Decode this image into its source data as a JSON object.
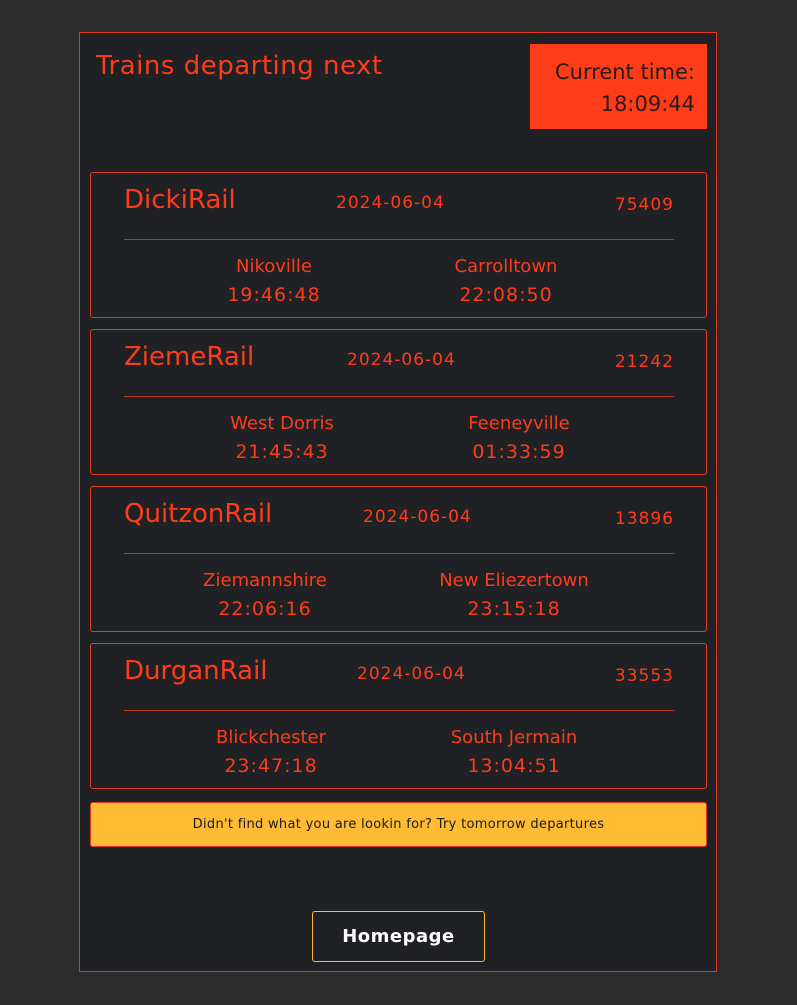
{
  "header": {
    "title": "Trains departing next",
    "current_time_label": "Current time:",
    "current_time_value": "18:09:44"
  },
  "departures": [
    {
      "operator": "DickiRail",
      "date": "2024-06-04",
      "number": "75409",
      "from_station": "Nikoville",
      "from_time": "19:46:48",
      "to_station": "Carrolltown",
      "to_time": "22:08:50"
    },
    {
      "operator": "ZiemeRail",
      "date": "2024-06-04",
      "number": "21242",
      "from_station": "West Dorris",
      "from_time": "21:45:43",
      "to_station": "Feeneyville",
      "to_time": "01:33:59"
    },
    {
      "operator": "QuitzonRail",
      "date": "2024-06-04",
      "number": "13896",
      "from_station": "Ziemannshire",
      "from_time": "22:06:16",
      "to_station": "New Eliezertown",
      "to_time": "23:15:18"
    },
    {
      "operator": "DurganRail",
      "date": "2024-06-04",
      "number": "33553",
      "from_station": "Blickchester",
      "from_time": "23:47:18",
      "to_station": "South Jermain",
      "to_time": "13:04:51"
    }
  ],
  "tomorrow_button": "Didn't find what you are lookin for? Try tomorrow departures",
  "homepage_button": "Homepage",
  "colors": {
    "background": "#2b2b2b",
    "panel": "#1f2124",
    "accent": "#ff3c1a",
    "warning": "#ffbb33"
  }
}
